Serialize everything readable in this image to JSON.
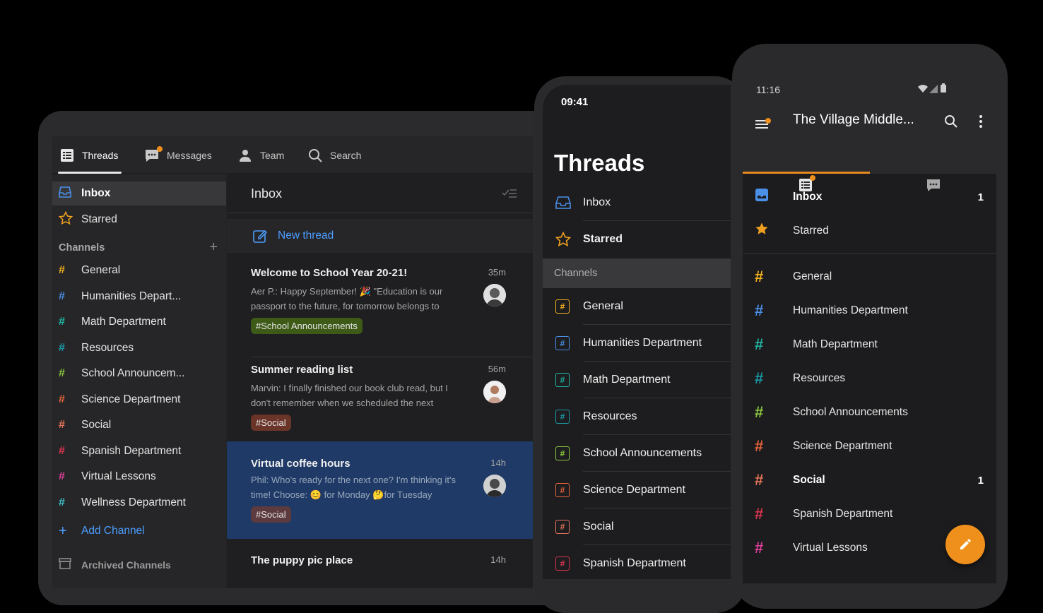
{
  "colors": {
    "accent_orange": "#f0901c",
    "link_blue": "#4d9dff",
    "selected_thread": "#1f3a66"
  },
  "tablet": {
    "nav": [
      {
        "label": "Threads",
        "icon": "threads-icon"
      },
      {
        "label": "Messages",
        "icon": "messages-icon"
      },
      {
        "label": "Team",
        "icon": "team-icon"
      },
      {
        "label": "Search",
        "icon": "search-icon"
      }
    ],
    "sidebar": {
      "inbox": "Inbox",
      "starred": "Starred",
      "channels_header": "Channels",
      "channels": [
        {
          "name": "General",
          "color": "#f2b11d"
        },
        {
          "name": "Humanities Depart...",
          "color": "#4a8fe8"
        },
        {
          "name": "Math Department",
          "color": "#1fb5a4"
        },
        {
          "name": "Resources",
          "color": "#1a9aa8"
        },
        {
          "name": "School Announcem...",
          "color": "#8cc83e"
        },
        {
          "name": "Science Department",
          "color": "#e8643a"
        },
        {
          "name": "Social",
          "color": "#e8745a"
        },
        {
          "name": "Spanish Department",
          "color": "#d9344e"
        },
        {
          "name": "Virtual Lessons",
          "color": "#e0409a"
        },
        {
          "name": "Wellness Department",
          "color": "#3ec0c8"
        }
      ],
      "add_channel": "Add Channel",
      "archived": "Archived Channels"
    },
    "main": {
      "title": "Inbox",
      "new_thread": "New thread",
      "threads": [
        {
          "title": "Welcome to School Year 20-21!",
          "time": "35m",
          "preview": "Aer P.: Happy September! 🎉 \"Education is our passport to the future, for tomorrow belongs to",
          "tag": "#School Announcements",
          "tag_color": "#3d5a17"
        },
        {
          "title": "Summer reading list",
          "time": "56m",
          "preview": "Marvin: I finally finished our book club read, but I don't remember when we scheduled the next",
          "tag": "#Social",
          "tag_color": "#6a3528"
        },
        {
          "title": "Virtual coffee hours",
          "time": "14h",
          "preview": "Phil: Who's ready for the next one? I'm thinking it's time! Choose: 😊 for Monday 🤔for Tuesday",
          "tag": "#Social",
          "tag_color": "#5c3a3e"
        },
        {
          "title": "The puppy pic place",
          "time": "14h"
        }
      ]
    }
  },
  "iphone": {
    "time": "09:41",
    "title": "Threads",
    "inbox": "Inbox",
    "starred": "Starred",
    "channels_header": "Channels",
    "channels": [
      {
        "name": "General",
        "color": "#f2b11d"
      },
      {
        "name": "Humanities Department",
        "color": "#4a8fe8"
      },
      {
        "name": "Math Department",
        "color": "#1fb5a4"
      },
      {
        "name": "Resources",
        "color": "#1a9aa8"
      },
      {
        "name": "School Announcements",
        "color": "#8cc83e"
      },
      {
        "name": "Science Department",
        "color": "#e8643a"
      },
      {
        "name": "Social",
        "color": "#e8745a"
      },
      {
        "name": "Spanish Department",
        "color": "#d9344e"
      }
    ]
  },
  "android": {
    "time": "11:16",
    "title": "The Village Middle...",
    "inbox": "Inbox",
    "inbox_count": "1",
    "starred": "Starred",
    "channels": [
      {
        "name": "General",
        "color": "#f2b11d",
        "count": ""
      },
      {
        "name": "Humanities Department",
        "color": "#4a8fe8",
        "count": ""
      },
      {
        "name": "Math Department",
        "color": "#1fb5a4",
        "count": ""
      },
      {
        "name": "Resources",
        "color": "#1a9aa8",
        "count": ""
      },
      {
        "name": "School Announcements",
        "color": "#8cc83e",
        "count": ""
      },
      {
        "name": "Science Department",
        "color": "#e8643a",
        "count": ""
      },
      {
        "name": "Social",
        "color": "#e8745a",
        "count": "1"
      },
      {
        "name": "Spanish Department",
        "color": "#d9344e",
        "count": ""
      },
      {
        "name": "Virtual Lessons",
        "color": "#e0409a",
        "count": ""
      }
    ]
  }
}
